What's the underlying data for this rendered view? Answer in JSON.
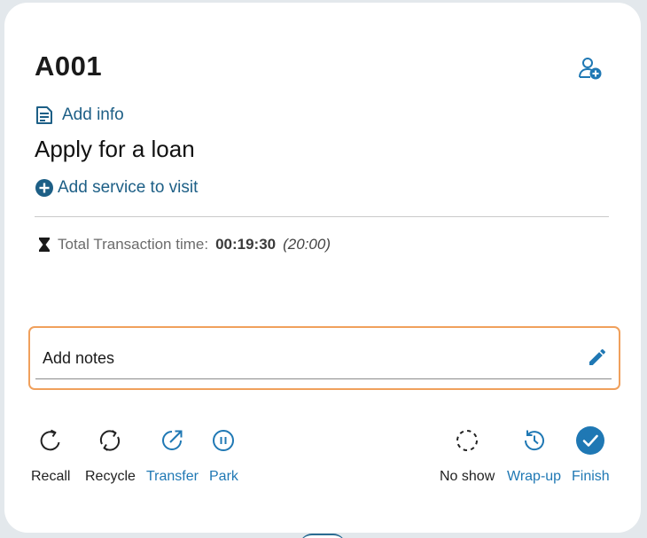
{
  "ticket": {
    "number": "A001"
  },
  "header": {
    "add_customer_icon": "person-add-icon"
  },
  "add_info": {
    "label": "Add info",
    "icon": "document-icon"
  },
  "service": {
    "name": "Apply for a loan"
  },
  "add_service": {
    "label": "Add service to visit",
    "icon": "plus-circle-icon"
  },
  "transaction": {
    "label": "Total Transaction time:",
    "elapsed": "00:19:30",
    "target": "(20:00)",
    "icon": "hourglass-icon"
  },
  "notes": {
    "placeholder": "Add notes",
    "icon": "pencil-icon"
  },
  "actions": {
    "recall": {
      "label": "Recall",
      "icon": "recall-icon"
    },
    "recycle": {
      "label": "Recycle",
      "icon": "recycle-icon"
    },
    "transfer": {
      "label": "Transfer",
      "icon": "transfer-icon"
    },
    "park": {
      "label": "Park",
      "icon": "pause-icon"
    },
    "no_show": {
      "label": "No show",
      "icon": "dashed-circle-icon"
    },
    "wrap_up": {
      "label": "Wrap-up",
      "icon": "history-icon"
    },
    "finish": {
      "label": "Finish",
      "icon": "check-circle-icon"
    }
  },
  "colors": {
    "primary": "#1f78b4",
    "link": "#1d5f86",
    "notes_border": "#f0a05c",
    "text": "#1a1a1a",
    "background": "#e3e8ec"
  }
}
